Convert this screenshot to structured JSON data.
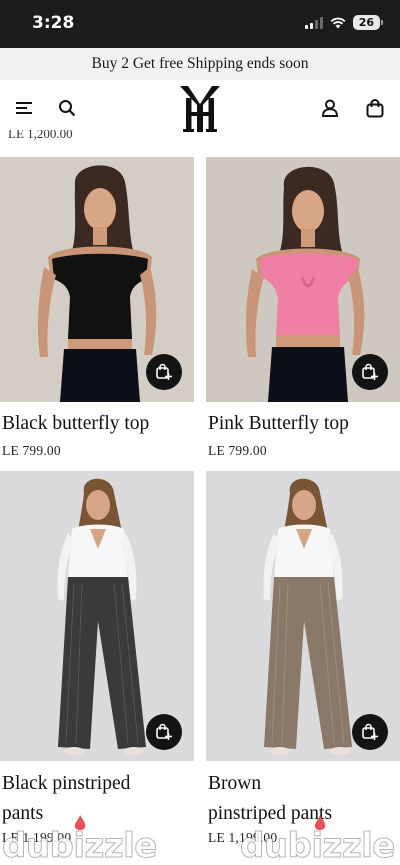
{
  "status_bar": {
    "time": "3:28",
    "battery": "26"
  },
  "announcement": "Buy 2 Get free Shipping ends soon",
  "header": {
    "logo_text": "YH"
  },
  "previous_price_cut": "LE 1,200.00",
  "products": [
    {
      "title_lines": [
        "Black butterfly top"
      ],
      "price": "LE 799.00"
    },
    {
      "title_lines": [
        "Pink Butterfly top"
      ],
      "price": "LE 799.00"
    },
    {
      "title_lines": [
        "Black pinstriped",
        "pants"
      ],
      "price": "LE 1,199.00"
    },
    {
      "title_lines": [
        "Brown",
        "pinstriped pants"
      ],
      "price": "LE 1,199.00"
    }
  ],
  "watermark": "dubizzle",
  "colors": {
    "status_bar": "#1c1c1e",
    "announcement_bg": "#f1f1f1",
    "quick_add": "#141414",
    "pink_top": "#f07fa4"
  }
}
